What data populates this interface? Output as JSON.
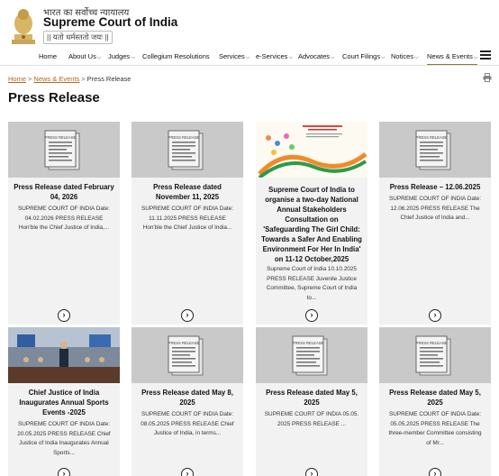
{
  "header": {
    "hindi_title": "भारत का सर्वोच्च न्यायालय",
    "site_title": "Supreme Court of India",
    "motto": "|| यतो धर्मस्ततो जयः ||"
  },
  "nav": {
    "items": [
      {
        "label": "Home"
      },
      {
        "label": "About Us"
      },
      {
        "label": "Judges"
      },
      {
        "label": "Collegium Resolutions"
      },
      {
        "label": "Services"
      },
      {
        "label": "e-Services"
      },
      {
        "label": "Advocates"
      },
      {
        "label": "Court Filings"
      },
      {
        "label": "Notices"
      },
      {
        "label": "News & Events"
      }
    ],
    "active": "News & Events"
  },
  "breadcrumb": {
    "home": "Home",
    "news": "News & Events",
    "current": "Press Release",
    "sep": ">"
  },
  "page_title": "Press Release",
  "cards": [
    {
      "title": "Press Release dated February 04, 2026",
      "body": "SUPREME COURT OF INDIA Date: 04.02.2026 PRESS RELEASE Hon'ble the Chief Justice of India,...",
      "thumb": "document-icon"
    },
    {
      "title": "Press Release dated November 11, 2025",
      "body": "SUPREME COURT OF INDIA Date: 11.11.2025 PRESS RELEASE Hon'ble the Chief Justice of India...",
      "thumb": "document-icon"
    },
    {
      "title": "Supreme Court of India to organise a two-day National Annual Stakeholders Consultation on 'Safeguarding The Girl Child: Towards a Safer And Enabling Environment For Her In India' on 11-12 October,2025",
      "body": "Supreme Court of India 10.10.2025 PRESS RELEASE Juvenile Justice Committee, Supreme Court of India to...",
      "thumb": "poster-image"
    },
    {
      "title": "Press Release – 12.06.2025",
      "body": "SUPREME COURT OF INDIA Date: 12.06.2025 PRESS RELEASE The Chief Justice of India and...",
      "thumb": "document-icon"
    },
    {
      "title": "Chief Justice of India Inaugurates Annual Sports Events -2025",
      "body": "SUPREME COURT OF INDIA Date: 20.05.2025 PRESS RELEASE Chief Justice of India Inaugurates Annual Sports...",
      "thumb": "event-photo"
    },
    {
      "title": "Press Release dated May 8, 2025",
      "body": "SUPREME COURT OF INDIA Date: 08.05.2025 PRESS RELEASE Chief Justice of India, in terms...",
      "thumb": "document-icon"
    },
    {
      "title": "Press Release dated May 5, 2025",
      "body": "SUPREME COURT OF INDIA 05.05. 2025 PRESS RELEASE ...",
      "thumb": "document-icon"
    },
    {
      "title": "Press Release dated May 5, 2025",
      "body": "SUPREME COURT OF INDIA Date: 05.05.2025 PRESS RELEASE The three-member Committee consisting of Mr...",
      "thumb": "document-icon"
    }
  ],
  "doc_icon_label": "PRESS RELEASE",
  "arrow_glyph": "›"
}
